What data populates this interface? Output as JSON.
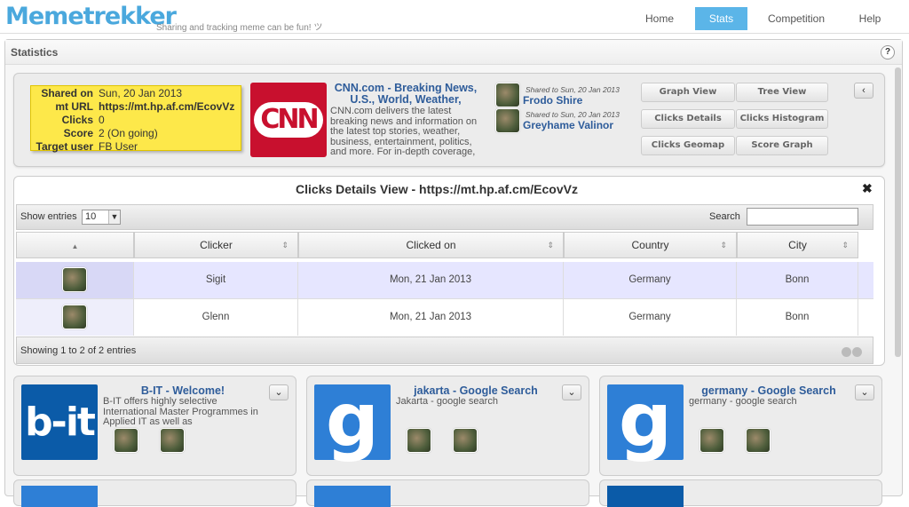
{
  "app": {
    "logo": "Memetrekker",
    "tagline": "Sharing and tracking meme can be fun! ツ"
  },
  "nav": [
    {
      "label": "Home"
    },
    {
      "label": "Stats",
      "active": true
    },
    {
      "label": "Competition"
    },
    {
      "label": "Help"
    }
  ],
  "page": {
    "title": "Statistics",
    "help": "?"
  },
  "meme": {
    "fields": [
      {
        "key": "Shared on",
        "value": "Sun, 20 Jan 2013"
      },
      {
        "key": "mt URL",
        "value": "https://mt.hp.af.cm/EcovVz"
      },
      {
        "key": "Clicks",
        "value": "0"
      },
      {
        "key": "Score",
        "value": "2 (On going)"
      },
      {
        "key": "Target user",
        "value": "FB User"
      }
    ],
    "logo_text": "CNN",
    "title": "CNN.com - Breaking News, U.S., World, Weather,",
    "description": "CNN.com delivers the latest breaking news and information on the latest top stories, weather, business, entertainment, politics, and more. For in-depth coverage,",
    "shares": [
      {
        "shared_prefix": "Shared to",
        "date": "Sun, 20 Jan 2013",
        "name": "Frodo Shire"
      },
      {
        "shared_prefix": "Shared to",
        "date": "Sun, 20 Jan 2013",
        "name": "Greyhame Valinor"
      }
    ],
    "buttons": [
      "Graph View",
      "Tree View",
      "Clicks Details",
      "Clicks Histogram",
      "Clicks Geomap",
      "Score Graph"
    ],
    "collapse": "‹"
  },
  "details": {
    "title": "Clicks Details View - https://mt.hp.af.cm/EcovVz",
    "close": "✖",
    "show_entries_label": "Show entries",
    "show_entries_value": "10",
    "search_label": "Search",
    "columns": [
      "",
      "Clicker",
      "Clicked on",
      "Country",
      "City"
    ],
    "rows": [
      {
        "clicker": "Sigit",
        "clicked_on": "Mon, 21 Jan 2013",
        "country": "Germany",
        "city": "Bonn"
      },
      {
        "clicker": "Glenn",
        "clicked_on": "Mon, 21 Jan 2013",
        "country": "Germany",
        "city": "Bonn"
      }
    ],
    "footer": "Showing 1 to 2 of 2 entries"
  },
  "cards": [
    {
      "title": "B-IT - Welcome!",
      "description": "B-IT offers highly selective International Master Programmes in Applied IT as well as",
      "logo_text": "b-it",
      "color": "#0b5ba8"
    },
    {
      "title": "jakarta - Google Search",
      "description": "Jakarta - google search",
      "logo_text": "g",
      "color": "#2e7fd6"
    },
    {
      "title": "germany - Google Search",
      "description": "germany - google search",
      "logo_text": "g",
      "color": "#2e7fd6"
    }
  ],
  "colors": {
    "accent": "#5bb5e8",
    "link": "#2e5c9a",
    "sticky": "#fde84a",
    "cnn_red": "#c8102e",
    "selected_row": "#e6e6ff"
  }
}
